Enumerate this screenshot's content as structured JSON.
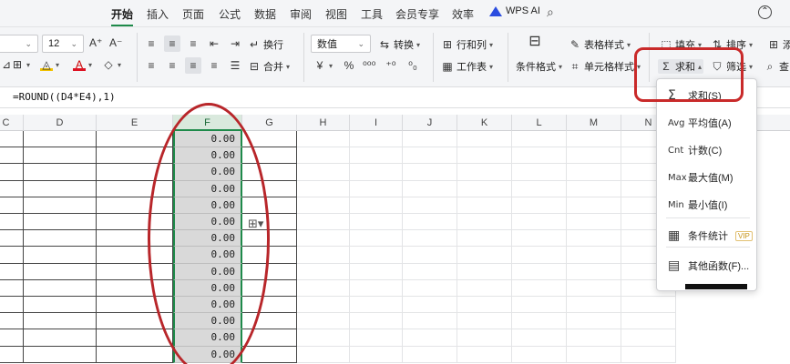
{
  "menubar": {
    "items": [
      "开始",
      "插入",
      "页面",
      "公式",
      "数据",
      "审阅",
      "视图",
      "工具",
      "会员专享",
      "效率"
    ],
    "ai_label": "WPS AI"
  },
  "ribbon": {
    "font_size": "12",
    "number_format": "数值",
    "wrap_label": "换行",
    "merge_label": "合并",
    "convert_label": "转换",
    "rows_cols_label": "行和列",
    "worksheet_label": "工作表",
    "cond_format_label": "条件格式",
    "table_style_label": "表格样式",
    "cell_style_label": "单元格样式",
    "fill_label": "填充",
    "sort_label": "排序",
    "sum_label": "求和",
    "filter_label": "筛选",
    "find_label": "查",
    "add_label": "添"
  },
  "formula": "=ROUND((D4*E4),1)",
  "columns": [
    "C",
    "D",
    "E",
    "F",
    "G",
    "H",
    "I",
    "J",
    "K",
    "L",
    "M",
    "N"
  ],
  "selected_column": "F",
  "grid": {
    "c_value": "G",
    "f_value": "0.00",
    "row_count": 14
  },
  "dropdown": {
    "items": [
      {
        "lead": "Σ",
        "label": "求和(S)"
      },
      {
        "lead": "Avg",
        "label": "平均值(A)"
      },
      {
        "lead": "Cnt",
        "label": "计数(C)"
      },
      {
        "lead": "Max",
        "label": "最大值(M)"
      },
      {
        "lead": "Min",
        "label": "最小值(I)"
      },
      {
        "lead": "▦",
        "label": "条件统计",
        "badge": "VIP"
      },
      {
        "lead": "▤",
        "label": "其他函数(F)..."
      }
    ]
  },
  "colors": {
    "accent": "#1e8a4a",
    "highlight_red": "#c92a2a",
    "selected_fill": "#d9d9d9"
  }
}
